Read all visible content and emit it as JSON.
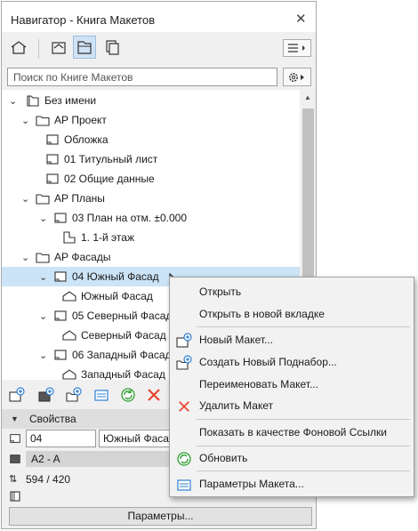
{
  "window": {
    "title": "Навигатор - Книга Макетов",
    "close_glyph": "✕"
  },
  "search": {
    "placeholder": "Поиск по Книге Макетов"
  },
  "tree": {
    "rows": [
      {
        "label": "Без имени",
        "icon": "book-icon"
      },
      {
        "label": "АР Проект",
        "icon": "folder-icon"
      },
      {
        "label": "Обложка",
        "icon": "layout-icon"
      },
      {
        "label": "01 Титульный лист",
        "icon": "layout-icon"
      },
      {
        "label": "02 Общие данные",
        "icon": "layout-icon"
      },
      {
        "label": "АР Планы",
        "icon": "folder-icon"
      },
      {
        "label": "03 План на отм. ±0.000",
        "icon": "layout-icon"
      },
      {
        "label": "1. 1-й этаж",
        "icon": "floor-plan-drawing-icon"
      },
      {
        "label": "АР Фасады",
        "icon": "folder-icon"
      },
      {
        "label": "04 Южный Фасад",
        "icon": "layout-icon",
        "selected": true
      },
      {
        "label": "Южный Фасад",
        "icon": "elevation-drawing-icon"
      },
      {
        "label": "05 Северный Фасад",
        "icon": "layout-icon"
      },
      {
        "label": "Северный Фасад",
        "icon": "elevation-drawing-icon"
      },
      {
        "label": "06 Западный Фасад",
        "icon": "layout-icon"
      },
      {
        "label": "Западный Фасад",
        "icon": "elevation-drawing-icon"
      }
    ]
  },
  "properties": {
    "header": "Свойства",
    "number": "04",
    "name": "Южный Фасад",
    "master": "A2 - A",
    "size": "594 / 420",
    "button": "Параметры..."
  },
  "context_menu": {
    "items": [
      {
        "label": "Открыть",
        "icon": ""
      },
      {
        "label": "Открыть в новой вкладке",
        "icon": ""
      },
      {
        "label": "Новый Макет...",
        "icon": "new-layout-icon"
      },
      {
        "label": "Создать Новый Поднабор...",
        "icon": "new-subset-icon"
      },
      {
        "label": "Переименовать Макет...",
        "icon": ""
      },
      {
        "label": "Удалить Макет",
        "icon": "delete-icon"
      },
      {
        "label": "Показать в качестве Фоновой Ссылки",
        "icon": ""
      },
      {
        "label": "Обновить",
        "icon": "update-icon"
      },
      {
        "label": "Параметры Макета...",
        "icon": "layout-settings-icon"
      }
    ]
  },
  "colors": {
    "selection": "#cce4f7",
    "delete": "#e8442c",
    "update": "#2e9e2e",
    "accent": "#2d7fd3"
  }
}
